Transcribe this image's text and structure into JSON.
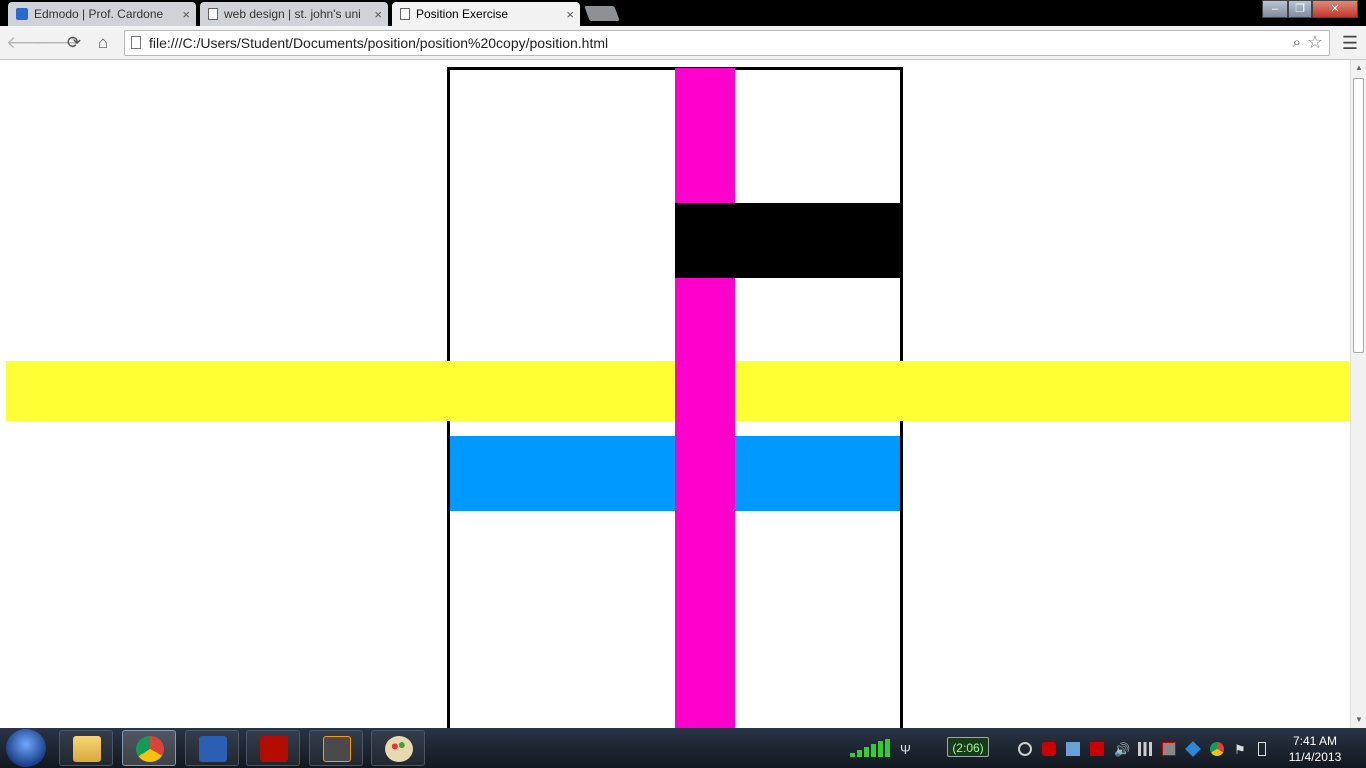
{
  "browser": {
    "tabs": [
      {
        "label": "Edmodo | Prof. Cardone",
        "active": false,
        "icon": "edmodo-icon"
      },
      {
        "label": "web design | st. john's uni",
        "active": false,
        "icon": "page-icon"
      },
      {
        "label": "Position Exercise",
        "active": true,
        "icon": "page-icon"
      }
    ],
    "tab_close_glyph": "×",
    "url": "file:///C:/Users/Student/Documents/position/position%20copy/position.html",
    "window_controls": [
      "minimize",
      "restore",
      "close"
    ]
  },
  "page": {
    "colors": {
      "container_border": "#000000",
      "magenta_bar": "#ff00cc",
      "black_box": "#000000",
      "yellow_bar": "#ffff33",
      "blue_bar": "#0099ff"
    }
  },
  "taskbar": {
    "apps": [
      "windows-explorer",
      "google-chrome",
      "microsoft-word",
      "adobe-reader",
      "sublime-text",
      "paint"
    ],
    "active_app": "google-chrome",
    "battery_text": "(2:06)",
    "time": "7:41 AM",
    "date": "11/4/2013"
  }
}
